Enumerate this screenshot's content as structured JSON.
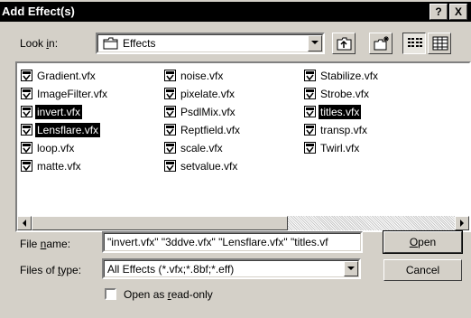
{
  "window": {
    "title": "Add Effect(s)",
    "help_btn": "?",
    "close_btn": "X"
  },
  "look_in": {
    "label_pre": "Look ",
    "label_key": "i",
    "label_post": "n:",
    "value": "Effects"
  },
  "files": [
    {
      "name": "Gradient.vfx",
      "selected": false
    },
    {
      "name": "ImageFilter.vfx",
      "selected": false
    },
    {
      "name": "invert.vfx",
      "selected": true
    },
    {
      "name": "Lensflare.vfx",
      "selected": true
    },
    {
      "name": "loop.vfx",
      "selected": false
    },
    {
      "name": "matte.vfx",
      "selected": false
    },
    {
      "name": "noise.vfx",
      "selected": false
    },
    {
      "name": "pixelate.vfx",
      "selected": false
    },
    {
      "name": "PsdlMix.vfx",
      "selected": false
    },
    {
      "name": "Reptfield.vfx",
      "selected": false
    },
    {
      "name": "scale.vfx",
      "selected": false
    },
    {
      "name": "setvalue.vfx",
      "selected": false
    },
    {
      "name": "Stabilize.vfx",
      "selected": false
    },
    {
      "name": "Strobe.vfx",
      "selected": false
    },
    {
      "name": "titles.vfx",
      "selected": true
    },
    {
      "name": "transp.vfx",
      "selected": false
    },
    {
      "name": "Twirl.vfx",
      "selected": false
    }
  ],
  "file_name": {
    "label_pre": "File ",
    "label_key": "n",
    "label_post": "ame:",
    "value": "\"invert.vfx\" \"3ddve.vfx\" \"Lensflare.vfx\" \"titles.vf"
  },
  "files_of_type": {
    "label_pre": "Files of ",
    "label_key": "t",
    "label_post": "ype:",
    "value": "All Effects (*.vfx;*.8bf;*.eff)"
  },
  "buttons": {
    "open_key": "O",
    "open_rest": "pen",
    "cancel": "Cancel"
  },
  "read_only": {
    "label_pre": "Open as ",
    "label_key": "r",
    "label_post": "ead-only",
    "checked": false
  }
}
